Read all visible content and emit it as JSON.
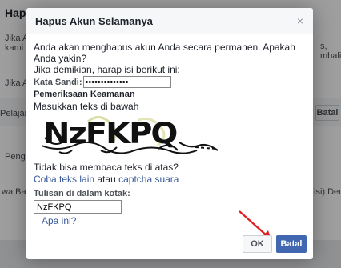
{
  "background": {
    "title": "Hapus",
    "lines": [
      "Jika Ar",
      "kami d",
      "Jika Ar",
      "Pelajari l",
      "Penge",
      "wa  Ba",
      "isi) Deu"
    ],
    "right_lines": [
      "s,",
      "mbali"
    ],
    "cancel_label": "Batal"
  },
  "dialog": {
    "title": "Hapus Akun Selamanya",
    "close_glyph": "×",
    "warning": "Anda akan menghapus akun Anda secara permanen. Apakah Anda yakin?",
    "confirm_prompt": "Jika demikian, harap isi berikut ini:",
    "password_label": "Kata Sandi:",
    "password_value": "••••••••••••••",
    "security_title": "Pemeriksaan Keamanan",
    "security_hint": "Masukkan teks di bawah",
    "captcha_text": "NzFKPQ",
    "cant_read": "Tidak bisa membaca teks di atas?",
    "try_other_link": "Coba teks lain",
    "or_text": "atau",
    "audio_link": "captcha suara",
    "answer_label": "Tulisan di dalam kotak:",
    "answer_value": "NzFKPQ",
    "help_link": "Apa ini?",
    "ok_label": "OK",
    "cancel_label": "Batal"
  },
  "colors": {
    "primary": "#4267b2",
    "link": "#365899",
    "arrow": "#e02020"
  }
}
